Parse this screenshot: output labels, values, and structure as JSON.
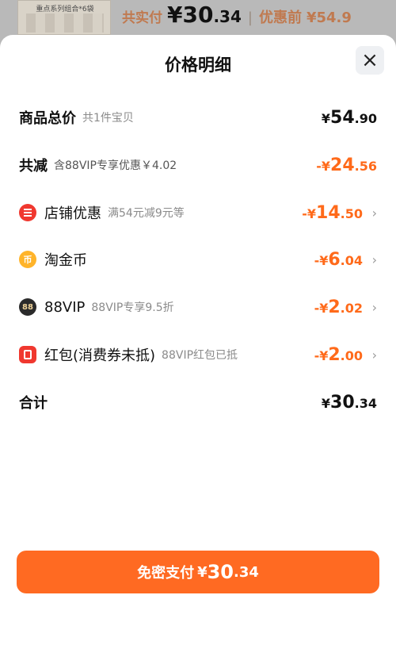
{
  "background": {
    "product_label": "重点系列组合*6袋",
    "paid_label": "共实付",
    "paid_currency": "¥",
    "paid_int": "30",
    "paid_dec": ".34",
    "divider": "|",
    "original_label": "优惠前",
    "original_amount": "¥54.9"
  },
  "sheet": {
    "title": "价格明细",
    "close_icon": "×"
  },
  "rows": {
    "total": {
      "label": "商品总价",
      "sub": "共1件宝贝",
      "cur": "¥",
      "int": "54",
      "dec": ".90"
    },
    "discount": {
      "label": "共减",
      "sub": "含88VIP专享优惠￥4.02",
      "cur": "-¥",
      "int": "24",
      "dec": ".56"
    },
    "store": {
      "icon": "store-coupon-icon",
      "label": "店铺优惠",
      "sub": "满54元减9元等",
      "cur": "-¥",
      "int": "14",
      "dec": ".50",
      "chevron": "›"
    },
    "taojinbi": {
      "icon": "coin-icon",
      "icon_text": "币",
      "label": "淘金币",
      "cur": "-¥",
      "int": "6",
      "dec": ".04",
      "chevron": "›"
    },
    "vip": {
      "icon": "88vip-icon",
      "icon_text": "88",
      "label": "88VIP",
      "sub": "88VIP专享9.5折",
      "cur": "-¥",
      "int": "2",
      "dec": ".02",
      "chevron": "›"
    },
    "redpacket": {
      "icon": "red-packet-icon",
      "label": "红包(消费券未抵)",
      "sub": "88VIP红包已抵",
      "cur": "-¥",
      "int": "2",
      "dec": ".00",
      "chevron": "›"
    },
    "sum": {
      "label": "合计",
      "cur": "¥",
      "int": "30",
      "dec": ".34"
    }
  },
  "pay_button": {
    "label": "免密支付",
    "cur": "¥",
    "int": "30",
    "dec": ".34"
  },
  "colors": {
    "accent": "#ff6a1a",
    "button": "#ff6a22",
    "store_icon": "#f0382f",
    "coin_icon": "#ffb42a",
    "vip_icon": "#2b2b2b"
  }
}
